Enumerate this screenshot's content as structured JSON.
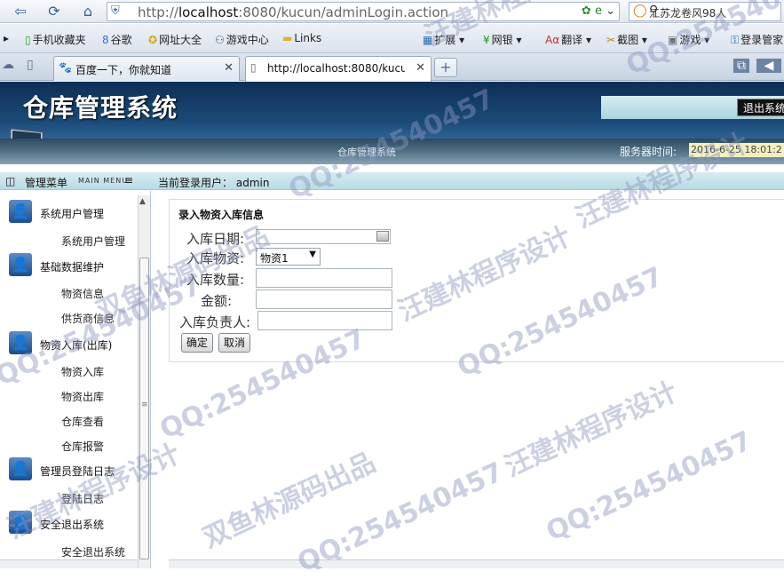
{
  "browser": {
    "url_prefix": "http://",
    "url_host": "localhost",
    "url_rest": ":8080/kucun/adminLogin.action",
    "search_text": "江苏龙卷风98人",
    "favorites": [
      {
        "label": "手机收藏夹",
        "icon": "phone-icon"
      },
      {
        "label": "谷歌",
        "icon": "google-icon"
      },
      {
        "label": "网址大全",
        "icon": "globe-icon"
      },
      {
        "label": "游戏中心",
        "icon": "gamepad-icon"
      },
      {
        "label": "Links",
        "icon": "folder-icon"
      },
      {
        "label": "扩展",
        "icon": "grid-icon"
      },
      {
        "label": "网银",
        "icon": "yen-icon"
      },
      {
        "label": "翻译",
        "icon": "translate-icon"
      },
      {
        "label": "截图",
        "icon": "scissors-icon"
      },
      {
        "label": "游戏",
        "icon": "game-icon"
      },
      {
        "label": "登录管家",
        "icon": "key-icon"
      }
    ],
    "tabs": [
      {
        "label": "百度一下，你就知道",
        "active": false
      },
      {
        "label": "http://localhost:8080/kucun/",
        "active": true
      }
    ]
  },
  "header": {
    "title": "仓库管理系统",
    "logout_label": "退出系统",
    "subtitle": "仓库管理系统",
    "server_time_label": "服务器时间:",
    "server_time": "2016-6-25 18:01:2"
  },
  "menubar": {
    "title": "管理菜单",
    "title_en": "MAIN MENU",
    "current_user_label": "当前登录用户：",
    "current_user": "admin"
  },
  "sidebar": {
    "groups": [
      {
        "label": "系统用户管理",
        "items": [
          "系统用户管理"
        ]
      },
      {
        "label": "基础数据维护",
        "items": [
          "物资信息",
          "供货商信息"
        ]
      },
      {
        "label": "物资入库(出库)",
        "items": [
          "物资入库",
          "物资出库",
          "仓库查看",
          "仓库报警"
        ]
      },
      {
        "label": "管理员登陆日志",
        "items": [
          "登陆日志"
        ]
      },
      {
        "label": "安全退出系统",
        "items": [
          "安全退出系统"
        ]
      }
    ]
  },
  "form": {
    "title": "录入物资入库信息",
    "date_label": "入库日期:",
    "date_value": "",
    "material_label": "入库物资:",
    "material_selected": "物资1",
    "qty_label": "入库数量:",
    "qty_value": "",
    "amount_label": "金额:",
    "amount_value": "",
    "person_label": "入库负责人:",
    "person_value": "",
    "confirm_label": "确定",
    "cancel_label": "取消"
  },
  "watermarks": {
    "qq": "QQ:254540457",
    "cn1": "汪建林程序设计",
    "cn2": "双鱼林源码出品"
  }
}
